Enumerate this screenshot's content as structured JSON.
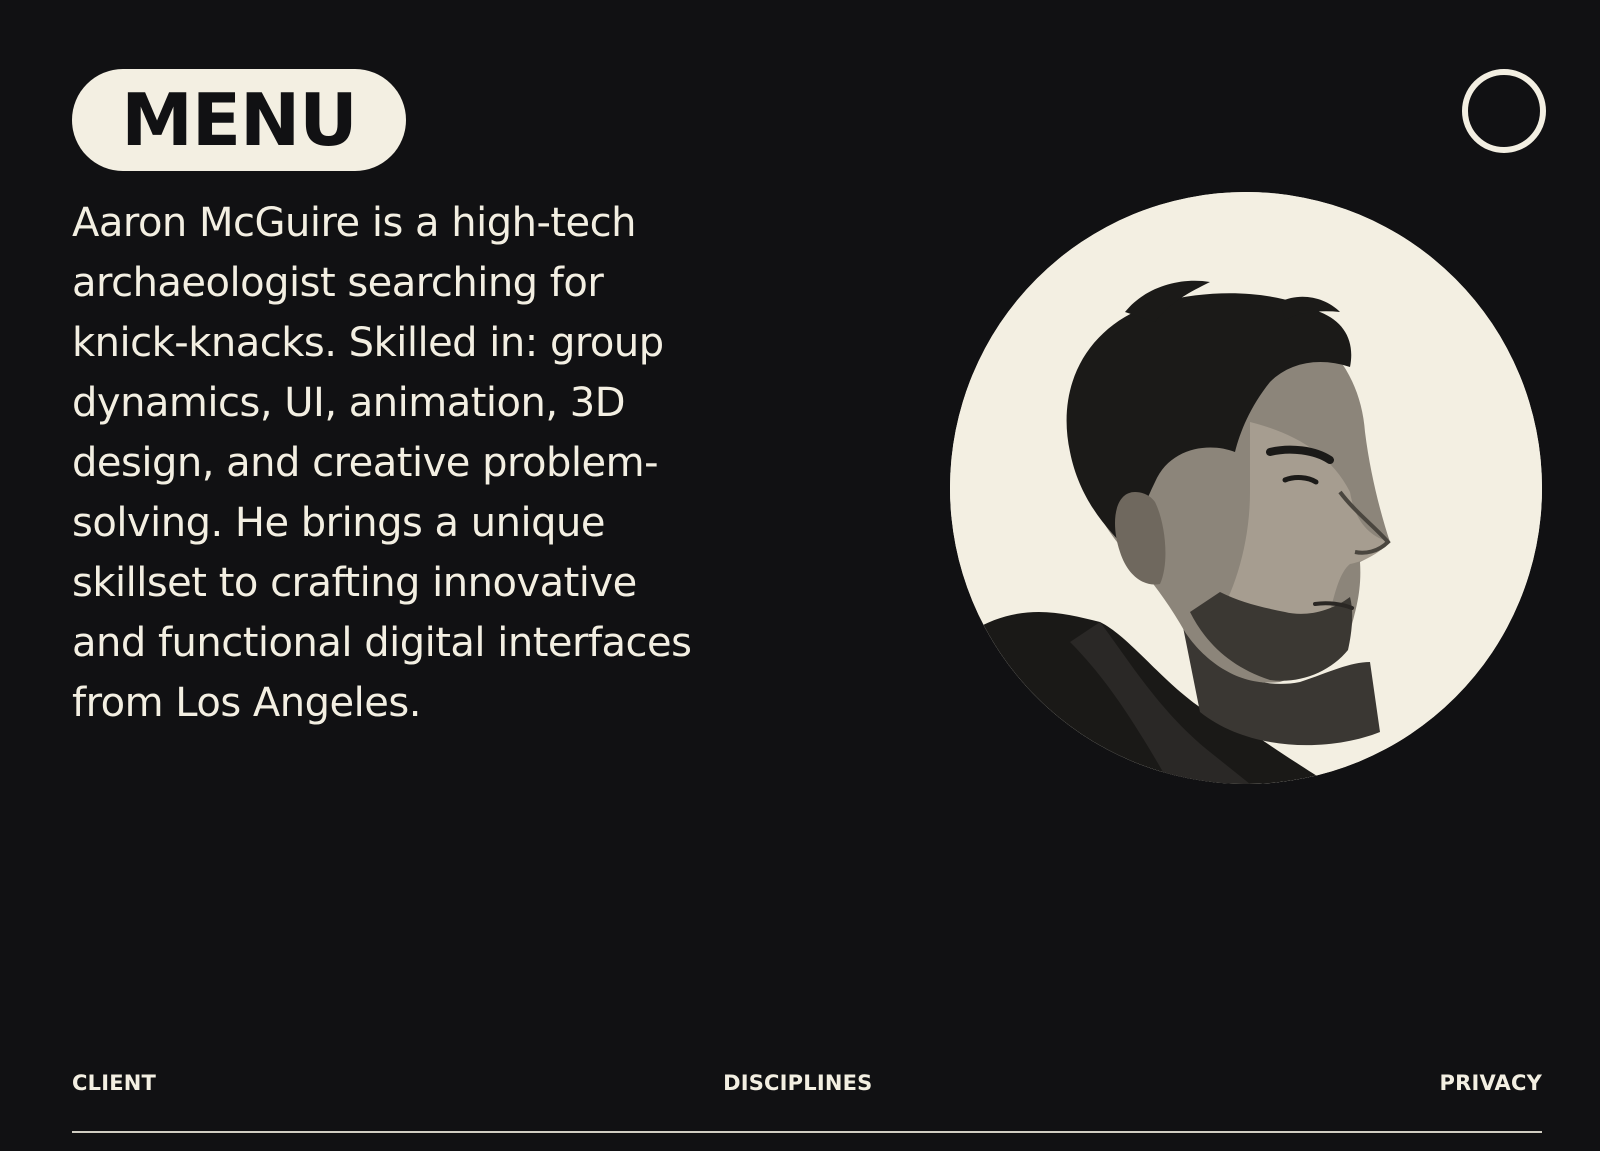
{
  "header": {
    "menu_label": "MENU",
    "circle_button_icon": "circle-outline-icon"
  },
  "bio": {
    "text": "Aaron McGuire is a high-tech archaeologist searching for knick-knacks. Skilled in: group dynamics, UI, animation, 3D design, and creative problem-solving. He brings a unique skillset to crafting innovative and functional digital interfaces from Los Angeles."
  },
  "portrait": {
    "subject": "portrait-photo",
    "background_color": "#f3efe2"
  },
  "footer": {
    "links": [
      "CLIENT",
      "DISCIPLINES",
      "PRIVACY"
    ]
  },
  "colors": {
    "background": "#111113",
    "foreground": "#f3efe2"
  }
}
